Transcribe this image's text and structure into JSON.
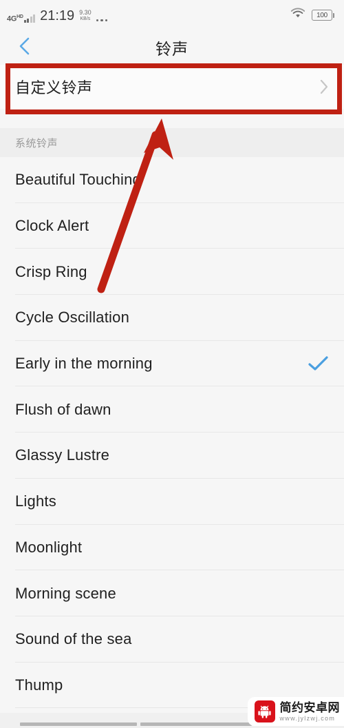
{
  "status_bar": {
    "network_type": "4G",
    "network_suffix": "HD",
    "time": "21:19",
    "net_speed_value": "9.30",
    "net_speed_unit": "KB/s",
    "overflow_icon": "more-dots-icon",
    "wifi_icon": "wifi-icon",
    "battery_level": "100"
  },
  "header": {
    "back_icon": "chevron-left-icon",
    "title": "铃声"
  },
  "custom_row": {
    "label": "自定义铃声",
    "chevron_icon": "chevron-right-icon"
  },
  "section": {
    "title": "系统铃声"
  },
  "ringtones": [
    {
      "name": "Beautiful Touching",
      "selected": false
    },
    {
      "name": "Clock Alert",
      "selected": false
    },
    {
      "name": "Crisp Ring",
      "selected": false
    },
    {
      "name": "Cycle Oscillation",
      "selected": false
    },
    {
      "name": "Early in the morning",
      "selected": true
    },
    {
      "name": "Flush of dawn",
      "selected": false
    },
    {
      "name": "Glassy Lustre",
      "selected": false
    },
    {
      "name": "Lights",
      "selected": false
    },
    {
      "name": "Moonlight",
      "selected": false
    },
    {
      "name": "Morning scene",
      "selected": false
    },
    {
      "name": "Sound of the sea",
      "selected": false
    },
    {
      "name": "Thump",
      "selected": false
    }
  ],
  "annotations": {
    "highlight_color": "#bf2113",
    "arrow_color": "#bf2113",
    "highlight_target": "自定义铃声"
  },
  "watermark": {
    "site_name": "简约安卓网",
    "site_url": "www.jylzwj.com",
    "logo_icon": "android-robot-icon",
    "logo_color": "#d9121b"
  },
  "colors": {
    "accent_blue": "#4a9fe0",
    "background": "#f6f6f6",
    "text_primary": "#1f1f1f",
    "text_secondary": "#9a9a9a"
  },
  "nav_bar": {
    "segments": 3
  }
}
